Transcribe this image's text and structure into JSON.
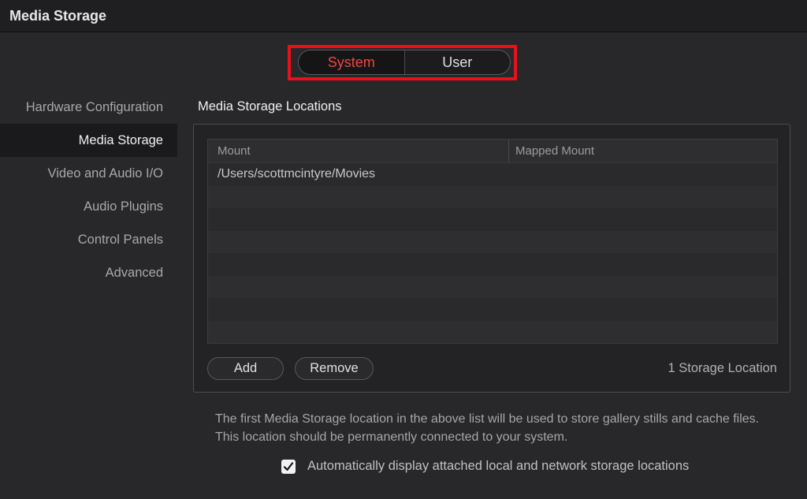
{
  "window": {
    "title": "Media Storage"
  },
  "toggle": {
    "system_label": "System",
    "user_label": "User",
    "active": "System",
    "active_color": "#f0453f",
    "highlight_color": "#e8101c"
  },
  "sidebar": {
    "items": [
      {
        "label": "Hardware Configuration",
        "active": false
      },
      {
        "label": "Media Storage",
        "active": true
      },
      {
        "label": "Video and Audio I/O",
        "active": false
      },
      {
        "label": "Audio Plugins",
        "active": false
      },
      {
        "label": "Control Panels",
        "active": false
      },
      {
        "label": "Advanced",
        "active": false
      }
    ]
  },
  "main": {
    "section_title": "Media Storage Locations",
    "table": {
      "columns": [
        "Mount",
        "Mapped Mount"
      ],
      "rows": [
        [
          "/Users/scottmcintyre/Movies",
          ""
        ],
        [
          "",
          ""
        ],
        [
          "",
          ""
        ],
        [
          "",
          ""
        ],
        [
          "",
          ""
        ],
        [
          "",
          ""
        ],
        [
          "",
          ""
        ],
        [
          "",
          ""
        ]
      ]
    },
    "add_label": "Add",
    "remove_label": "Remove",
    "count_label": "1 Storage Location",
    "note": "The first Media Storage location in the above list will be used to store gallery stills and cache files. This location should be permanently connected to your system.",
    "auto_display": {
      "label": "Automatically display attached local and network storage locations",
      "checked": true
    }
  }
}
